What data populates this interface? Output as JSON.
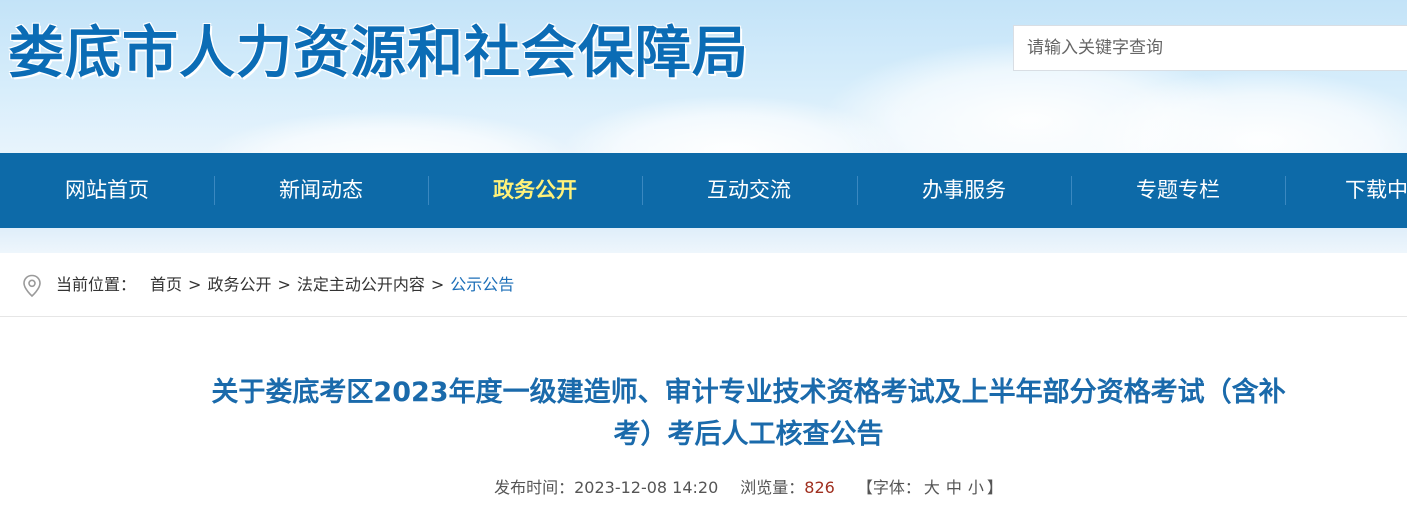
{
  "header": {
    "site_title": "娄底市人力资源和社会保障局",
    "search_placeholder": "请输入关键字查询"
  },
  "nav": {
    "items": [
      {
        "label": "网站首页"
      },
      {
        "label": "新闻动态"
      },
      {
        "label": "政务公开",
        "active": true
      },
      {
        "label": "互动交流"
      },
      {
        "label": "办事服务"
      },
      {
        "label": "专题专栏"
      },
      {
        "label": "下载中"
      }
    ]
  },
  "breadcrumb": {
    "label": "当前位置：",
    "items": [
      "首页",
      "政务公开",
      "法定主动公开内容",
      "公示公告"
    ],
    "separator": ">"
  },
  "article": {
    "title_line1": "关于娄底考区2023年度一级建造师、审计专业技术资格考试及上半年部分资格考试（含补",
    "title_line2": "考）考后人工核查公告",
    "publish_label": "发布时间：",
    "publish_time": "2023-12-08 14:20",
    "views_label": "浏览量：",
    "views": "826",
    "font_label_open": "【字体：",
    "font_large": "大",
    "font_medium": "中",
    "font_small": "小",
    "font_label_close": "】"
  },
  "colors": {
    "nav_bg": "#0d6aa8",
    "nav_active": "#fff27a",
    "title_blue": "#1a6aab",
    "breadcrumb_current": "#1d6fb8",
    "views_count": "#a03020"
  }
}
